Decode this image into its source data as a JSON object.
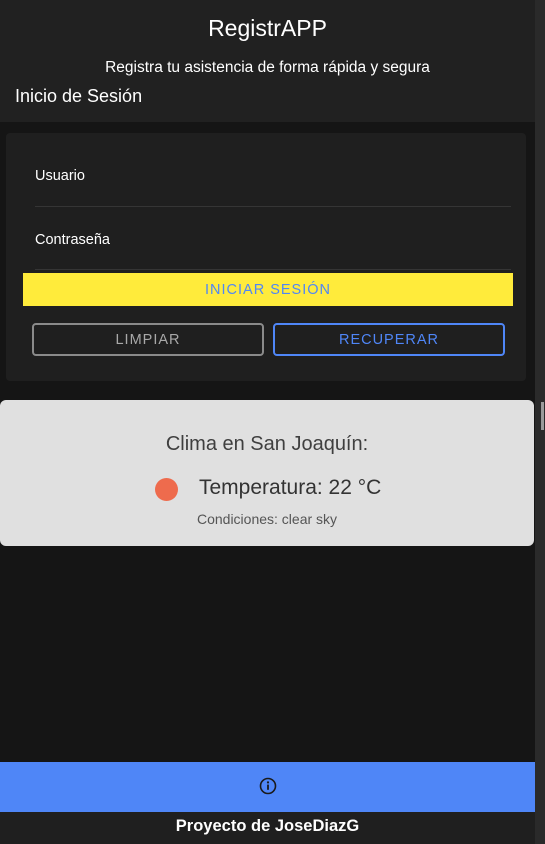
{
  "header": {
    "title": "RegistrAPP",
    "subtitle": "Registra tu asistencia de forma rápida y segura",
    "section_title": "Inicio de Sesión"
  },
  "login": {
    "username_label": "Usuario",
    "username_value": "",
    "password_label": "Contraseña",
    "password_value": "",
    "login_button": "INICIAR SESIÓN",
    "clear_button": "LIMPIAR",
    "recover_button": "RECUPERAR"
  },
  "weather": {
    "title": "Clima en San Joaquín:",
    "temperature": "Temperatura: 22 °C",
    "conditions": "Condiciones: clear sky",
    "indicator_color": "#ee6b4d"
  },
  "footer": {
    "icon": "info-icon",
    "text": "Proyecto de JoseDiazG"
  },
  "colors": {
    "accent_yellow": "#ffeb3b",
    "accent_blue": "#4f86f7",
    "background": "#151515"
  }
}
